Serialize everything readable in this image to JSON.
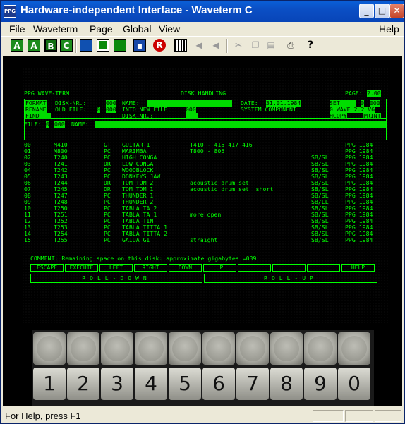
{
  "window": {
    "title": "Hardware-independent Interface - Waveterm C",
    "app_icon": "PPG",
    "minimize": "_",
    "maximize": "□",
    "close": "✕"
  },
  "menu": [
    "File",
    "Waveterm",
    "Page",
    "Global",
    "View",
    "Help"
  ],
  "toolbar": {
    "a": "A",
    "a2": "A",
    "b": "B",
    "c": "C",
    "icons": [
      "monitor-blue-icon",
      "monitor-green-icon",
      "monitor-green-2-icon",
      "save-icon",
      "record-icon",
      "keyboard-icon",
      "speaker-left-icon",
      "speaker-right-icon",
      "cut-icon",
      "copy-icon",
      "paste-icon",
      "print-icon",
      "help-icon"
    ],
    "record": "R",
    "help": "?"
  },
  "screen": {
    "title": "PPG WAVE-TERM",
    "mode": "DISK HANDLING",
    "page_label": "PAGE:",
    "page_value": "2.00",
    "format": "FORMAT",
    "rename": "RENAME",
    "find": "FIND",
    "file_label": "FILE:",
    "disk_nr": "DISK-NR.:",
    "disk_nr_val": "000",
    "name_label": "NAME:",
    "old_file": "OLD FILE:",
    "old_file_val1": "0",
    "old_file_val2": "000",
    "into_new_file": "INTO NEW FILE:",
    "into_new_file_val": "000",
    "disk_nr2": "DISK-NR.:",
    "date_label": "DATE:",
    "date_val": "31.01.1984",
    "set_label": "SET",
    "set_val1": "0",
    "set_val2": "000",
    "system_component": "SYSTEM COMPONENT:",
    "system_val": "0 WAVE 2.2 V6",
    "hcopy": "HCOPY",
    "print": "PRINT",
    "file_val1": "0",
    "file_val2": "000",
    "file_name": "NAME:",
    "rows": [
      {
        "n": "00",
        "code": "M410",
        "t": "GT",
        "name": "GUITAR 1",
        "info": "T410 - 415 417 416",
        "s": "",
        "p": "PPG 1984"
      },
      {
        "n": "01",
        "code": "M800",
        "t": "PC",
        "name": "MARIMBA",
        "info": "T800 - 805",
        "s": "",
        "p": "PPG 1984"
      },
      {
        "n": "02",
        "code": "T240",
        "t": "PC",
        "name": "HIGH CONGA",
        "info": "",
        "s": "SB/SL",
        "p": "PPG 1984"
      },
      {
        "n": "03",
        "code": "T241",
        "t": "DR",
        "name": "LOW CONGA",
        "info": "",
        "s": "SB/SL",
        "p": "PPG 1984"
      },
      {
        "n": "04",
        "code": "T242",
        "t": "PC",
        "name": "WOODBLOCK",
        "info": "",
        "s": "SB/SL",
        "p": "PPG 1984"
      },
      {
        "n": "05",
        "code": "T243",
        "t": "PC",
        "name": "DONKEYS JAW",
        "info": "",
        "s": "SB/SL",
        "p": "PPG 1984"
      },
      {
        "n": "06",
        "code": "T244",
        "t": "DR",
        "name": "TOM TOM 2",
        "info": "acoustic drum set",
        "s": "SB/SL",
        "p": "PPG 1984"
      },
      {
        "n": "07",
        "code": "T245",
        "t": "DR",
        "name": "TOM TOM 1",
        "info": "acoustic drum set  short",
        "s": "SB/SL",
        "p": "PPG 1984"
      },
      {
        "n": "08",
        "code": "T247",
        "t": "PC",
        "name": "THUNDER 1",
        "info": "",
        "s": "SB/SL",
        "p": "PPG 1984"
      },
      {
        "n": "09",
        "code": "T248",
        "t": "PC",
        "name": "THUNDER 2",
        "info": "",
        "s": "SB/LL",
        "p": "PPG 1984"
      },
      {
        "n": "10",
        "code": "T250",
        "t": "PC",
        "name": "TABLA TA 2",
        "info": "",
        "s": "SB/SL",
        "p": "PPG 1984"
      },
      {
        "n": "11",
        "code": "T251",
        "t": "PC",
        "name": "TABLA TA 1",
        "info": "more open",
        "s": "SB/SL",
        "p": "PPG 1984"
      },
      {
        "n": "12",
        "code": "T252",
        "t": "PC",
        "name": "TABLA TIN",
        "info": "",
        "s": "SB/SL",
        "p": "PPG 1984"
      },
      {
        "n": "13",
        "code": "T253",
        "t": "PC",
        "name": "TABLA TITTA 1",
        "info": "",
        "s": "SB/SL",
        "p": "PPG 1984"
      },
      {
        "n": "14",
        "code": "T254",
        "t": "PC",
        "name": "TABLA TITTA 2",
        "info": "",
        "s": "SB/SL",
        "p": "PPG 1984"
      },
      {
        "n": "15",
        "code": "T255",
        "t": "PC",
        "name": "GAIDA GI",
        "info": "straight",
        "s": "SB/SL",
        "p": "PPG 1984"
      }
    ],
    "comment": "COMMENT: Remaining space on this disk: approximate gigabytes =039",
    "fkeys": [
      "ESCAPE",
      "EXECUTE",
      "LEFT",
      "RIGHT",
      "DOWN",
      "UP",
      "",
      "",
      "",
      "HELP"
    ],
    "roll_down": "ROLL-DOWN",
    "roll_up": "ROLL-UP"
  },
  "keys": [
    "1",
    "2",
    "3",
    "4",
    "5",
    "6",
    "7",
    "8",
    "9",
    "0"
  ],
  "status": {
    "text": "For Help, press F1"
  }
}
